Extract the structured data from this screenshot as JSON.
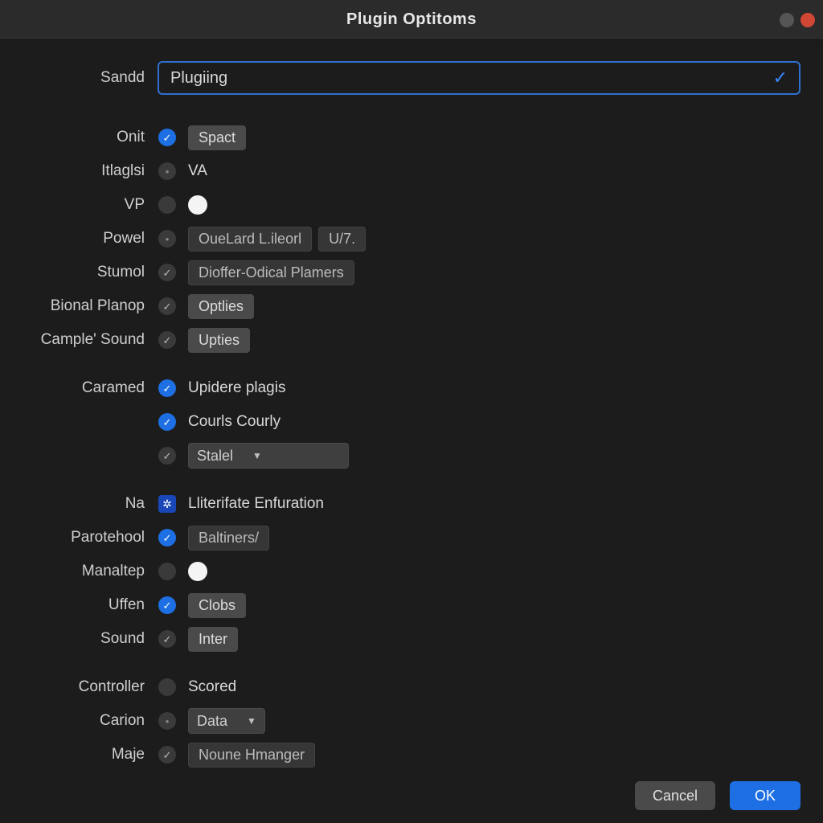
{
  "window": {
    "title": "Plugin Optitoms"
  },
  "search": {
    "label": "Sandd",
    "value": "Plugiing"
  },
  "rows": {
    "onit": {
      "label": "Onit",
      "chip": "Spact"
    },
    "itlaglsi": {
      "label": "Itlaglsi",
      "text": "VA"
    },
    "vp": {
      "label": "VP"
    },
    "powel": {
      "label": "Powel",
      "chip1": "OueLard L.ileorl",
      "chip2": "U/7."
    },
    "stumol": {
      "label": "Stumol",
      "chip": "Dioffer-Odical Plamers"
    },
    "bional": {
      "label": "Bional Planop",
      "chip": "Optlies"
    },
    "cample": {
      "label": "Cample' Sound",
      "chip": "Upties"
    },
    "caramed": {
      "label": "Caramed",
      "text": "Upidere plagis"
    },
    "courly": {
      "label": "",
      "text": "Courls Courly"
    },
    "stalel": {
      "label": "",
      "select": "Stalel"
    },
    "na": {
      "label": "Na",
      "text": "Lliterifate Enfuration"
    },
    "parotehool": {
      "label": "Parotehool",
      "chip": "Baltiners/"
    },
    "manaltep": {
      "label": "Manaltep"
    },
    "uffen": {
      "label": "Uffen",
      "chip": "Clobs"
    },
    "sound": {
      "label": "Sound",
      "chip": "Inter"
    },
    "controller": {
      "label": "Controller",
      "text": "Scored"
    },
    "carion": {
      "label": "Carion",
      "select": "Data"
    },
    "maje": {
      "label": "Maje",
      "chip": "Noune Hmanger"
    }
  },
  "footer": {
    "cancel": "Cancel",
    "ok": "OK"
  },
  "colors": {
    "accent": "#1d6fe3",
    "border_focus": "#2f6fd0",
    "chip_bg": "#3f3f3f"
  }
}
